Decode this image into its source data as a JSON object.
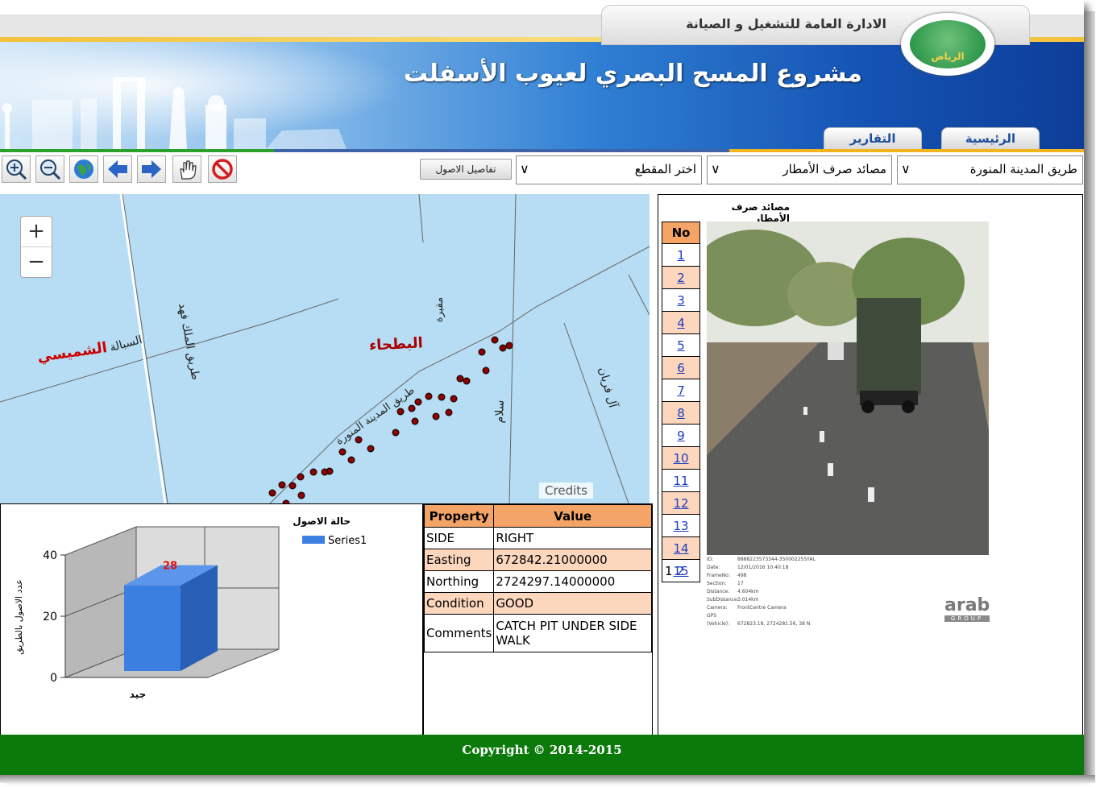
{
  "header": {
    "department": "الادارة العامة للتشغيل و الصيانة",
    "project_title": "مشروع المسح البصري لعيوب الأسفلت",
    "logo_text": "الرياض",
    "tabs": [
      "الرئيسية",
      "التقارير"
    ]
  },
  "toolbar": {
    "tools": [
      "zoom-in-icon",
      "zoom-out-icon",
      "globe-icon",
      "arrow-left-icon",
      "arrow-right-icon",
      "pan-hand-icon",
      "clear-icon"
    ],
    "assets_button": "تفاصيل الاصول",
    "selects": {
      "road": "طريق المدينة المنورة",
      "asset_type": "مصائد صرف الأمطار",
      "section": "اختر المقطع"
    }
  },
  "map": {
    "labels": {
      "shumaisi": "الشميسي",
      "sabala": "السبالة",
      "batha": "البطحاء",
      "king_fahd": "طريق الملك فهد",
      "madinah_road": "طريق المدينة المنورة",
      "salam": "سلام",
      "al_faryan": "آل فريان",
      "murabba": "مقبرة"
    },
    "zoom_in": "+",
    "zoom_out": "−",
    "credits": "Credits"
  },
  "chart_data": {
    "type": "bar",
    "title": "حالة الاصول",
    "categories": [
      "جيد"
    ],
    "series": [
      {
        "name": "Series1",
        "values": [
          28
        ]
      }
    ],
    "ylabel": "عدد الاصول بالطريق",
    "xlabel": "",
    "ylim": [
      0,
      40
    ],
    "yticks": [
      0,
      20,
      40
    ],
    "legend": "top-right",
    "grid": true,
    "colors": {
      "bar": "#3b7fe0"
    }
  },
  "properties": {
    "headers": [
      "Property",
      "Value"
    ],
    "rows": [
      [
        "SIDE",
        "RIGHT"
      ],
      [
        "Easting",
        "672842.21000000"
      ],
      [
        "Northing",
        "2724297.14000000"
      ],
      [
        "Condition",
        "GOOD"
      ],
      [
        "Comments",
        "CATCH PIT UNDER SIDE WALK"
      ]
    ]
  },
  "right_panel": {
    "title": "مصائد صرف الأمطار",
    "no_header": "No",
    "numbers": [
      "1",
      "2",
      "3",
      "4",
      "5",
      "6",
      "7",
      "8",
      "9",
      "10",
      "11",
      "12",
      "13",
      "14",
      "15"
    ],
    "pager_current": "1",
    "pager_next": "2",
    "image_meta": [
      [
        "ID:",
        "8888223573344-350002255YAL"
      ],
      [
        "Date:",
        "12/01/2016 10:40:18"
      ],
      [
        "FrameNo:",
        "498"
      ],
      [
        "Section:",
        "17"
      ],
      [
        "Distance:",
        "4.604km"
      ],
      [
        "SubDistance:",
        "3.014km"
      ],
      [
        "Camera:",
        "FrontCentre Camera"
      ],
      [
        "GPS (Vehicle):",
        "672823.18, 2724281.56, 38 N"
      ]
    ],
    "company_logo": "arab",
    "company_sub": "GROUP"
  },
  "footer": {
    "copyright": "Copyright © 2014-2015"
  },
  "colors": {
    "accent_orange": "#f5a468",
    "row_alt": "#fcd6bd",
    "footer_green": "#0b7a0b",
    "banner_blue": "#1553b3",
    "map_water": "#b6ddf3",
    "point_red": "#8b0000"
  }
}
